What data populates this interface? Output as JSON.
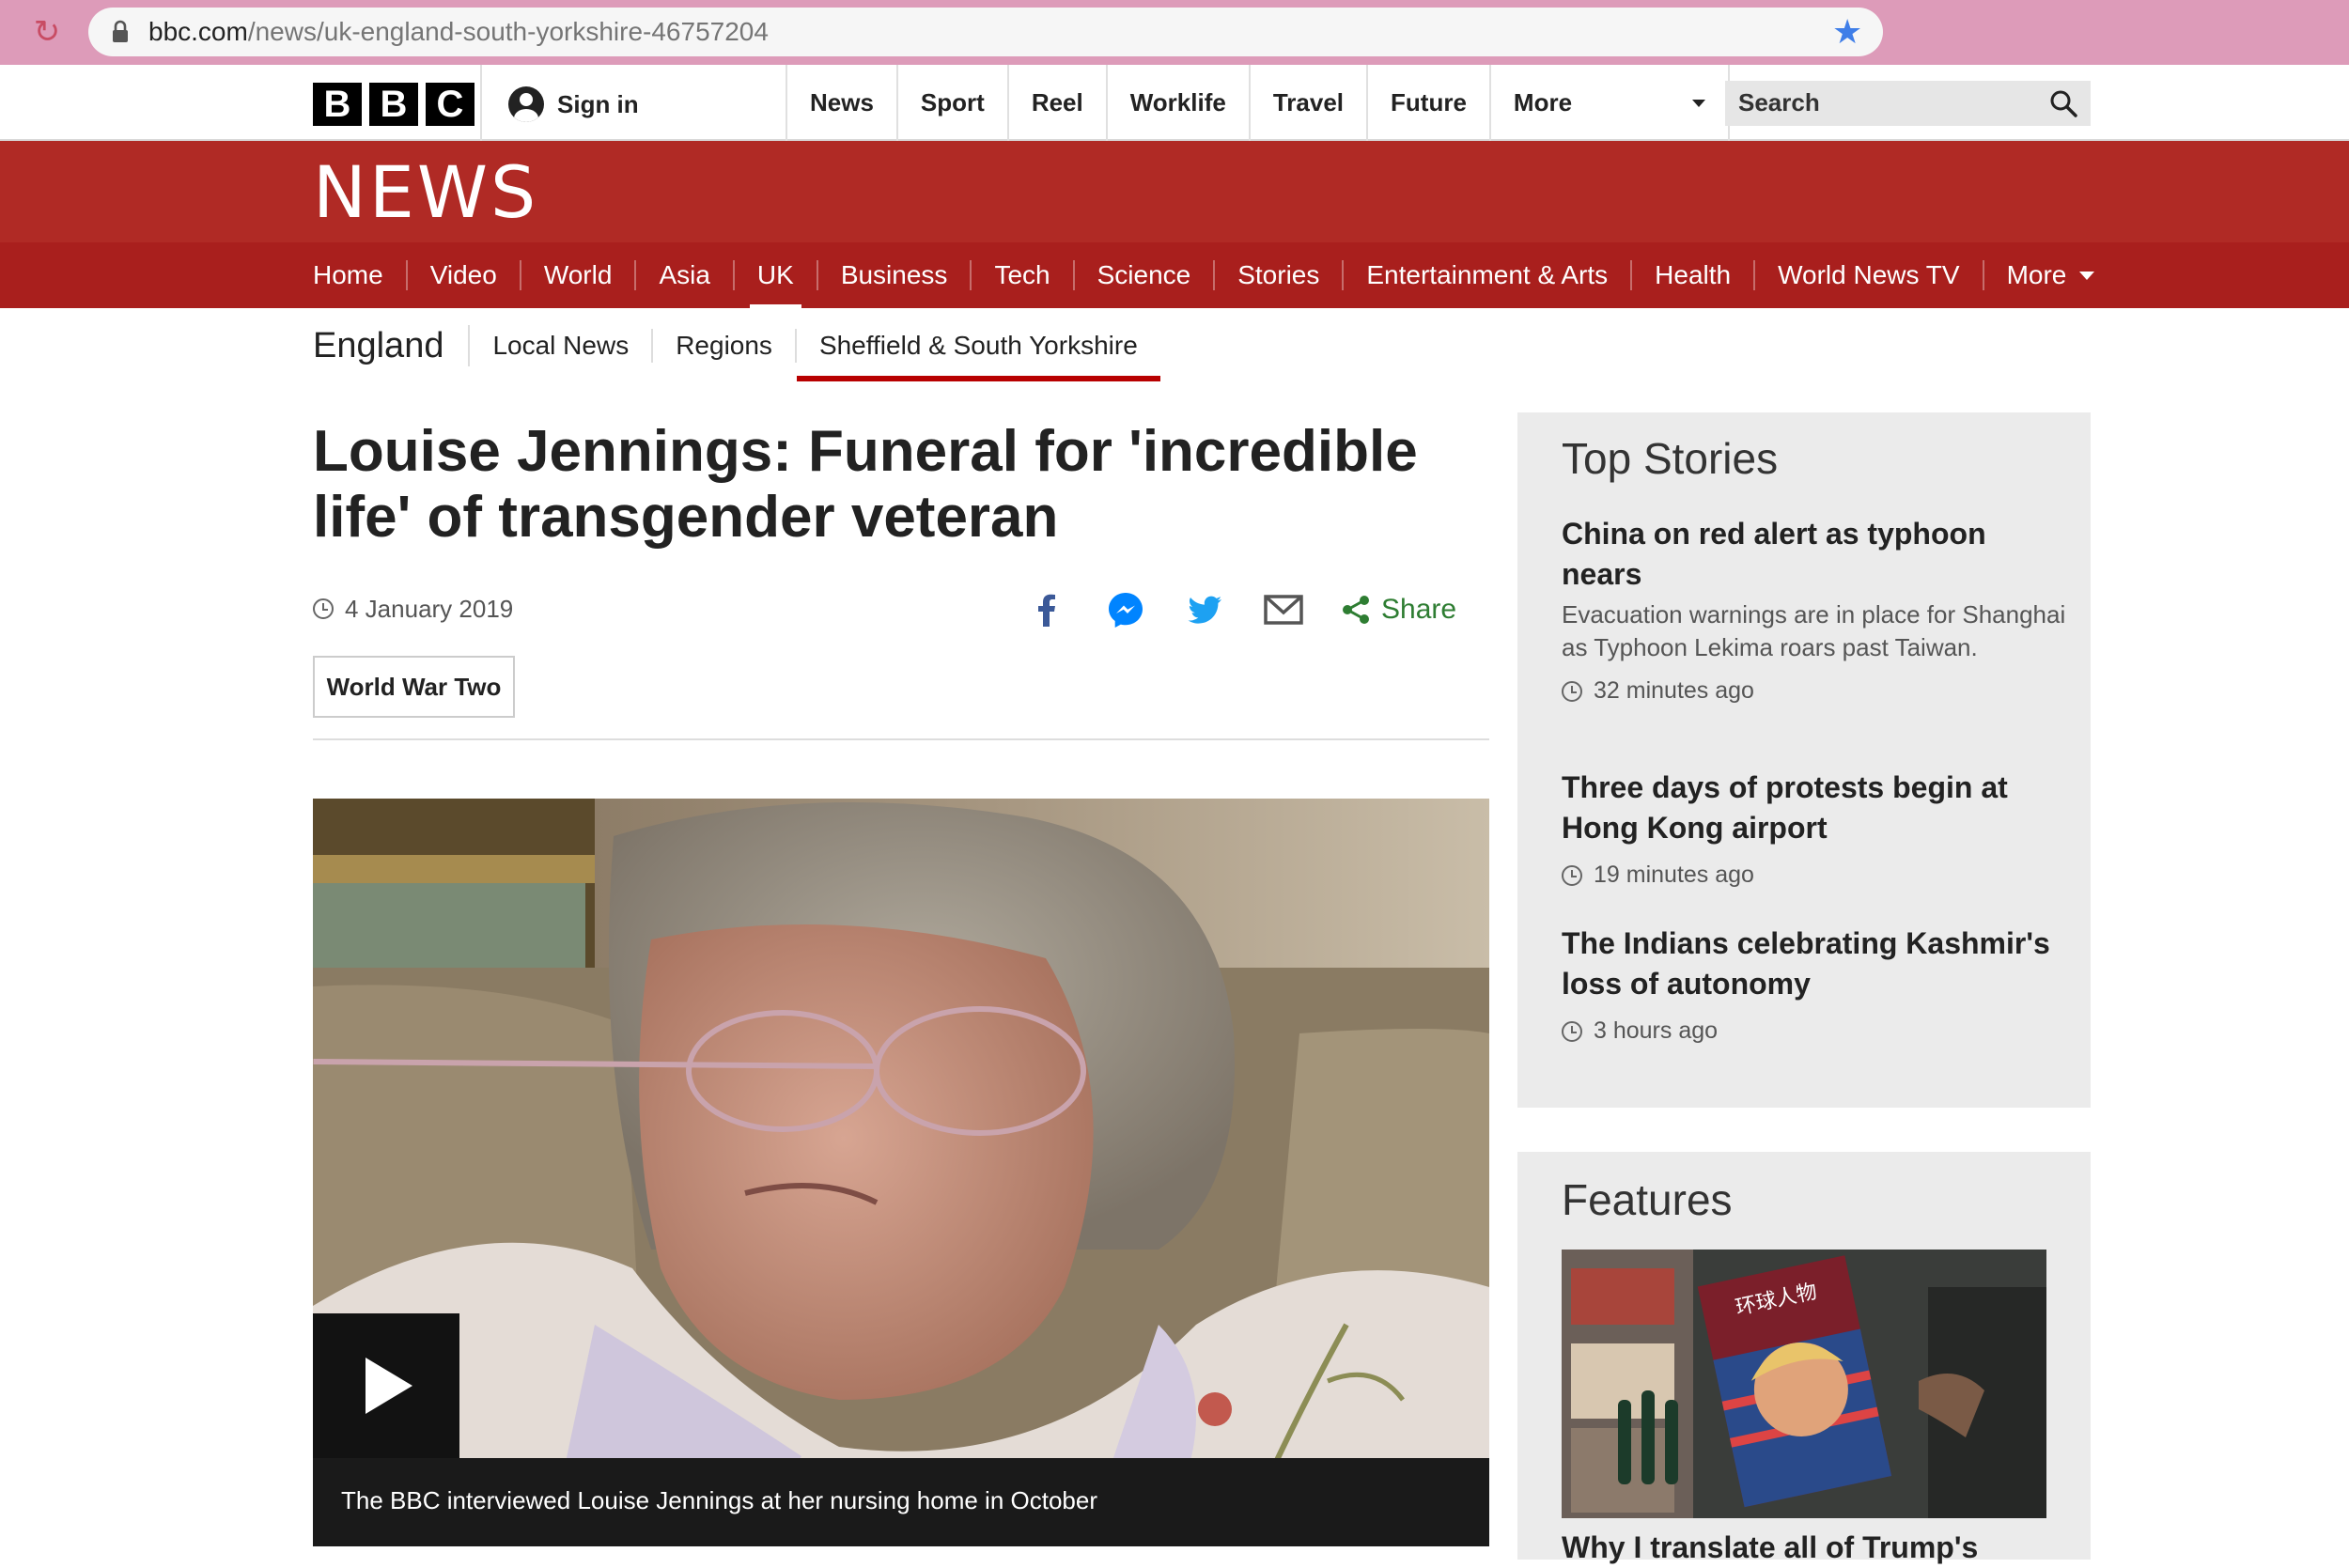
{
  "browser": {
    "url_host": "bbc.com",
    "url_path": "/news/uk-england-south-yorkshire-46757204"
  },
  "bbc_bar": {
    "logo_letters": [
      "B",
      "B",
      "C"
    ],
    "sign_in": "Sign in",
    "nav": [
      "News",
      "Sport",
      "Reel",
      "Worklife",
      "Travel",
      "Future"
    ],
    "more": "More",
    "search_placeholder": "Search"
  },
  "news": {
    "logo": "NEWS",
    "nav": [
      "Home",
      "Video",
      "World",
      "Asia",
      "UK",
      "Business",
      "Tech",
      "Science",
      "Stories",
      "Entertainment & Arts",
      "Health",
      "World News TV"
    ],
    "active": "UK",
    "more": "More"
  },
  "subnav": {
    "section": "England",
    "items": [
      "Local News",
      "Regions",
      "Sheffield & South Yorkshire"
    ],
    "active": "Sheffield & South Yorkshire"
  },
  "article": {
    "headline": "Louise Jennings: Funeral for 'incredible life' of transgender veteran",
    "date": "4 January 2019",
    "share_label": "Share",
    "tag": "World War Two",
    "caption": "The BBC interviewed Louise Jennings at her nursing home in October"
  },
  "share_icons": [
    "facebook-icon",
    "messenger-icon",
    "twitter-icon",
    "email-icon",
    "share-icon"
  ],
  "top_stories": {
    "title": "Top Stories",
    "items": [
      {
        "title": "China on red alert as typhoon nears",
        "summary": "Evacuation warnings are in place for Shanghai as Typhoon Lekima roars past Taiwan.",
        "time": "32 minutes ago"
      },
      {
        "title": "Three days of protests begin at Hong Kong airport",
        "time": "19 minutes ago"
      },
      {
        "title": "The Indians celebrating Kashmir's loss of autonomy",
        "time": "3 hours ago"
      }
    ]
  },
  "features": {
    "title": "Features",
    "item_title": "Why I translate all of Trump's",
    "image_magazine_text": "环球人物"
  },
  "colors": {
    "news_red": "#b02a25",
    "news_nav_red": "#a91f1d",
    "browser_pink": "#dd9bb9",
    "share_green": "#2e7d32",
    "facebook_blue": "#3b5998",
    "twitter_blue": "#1da1f2"
  }
}
